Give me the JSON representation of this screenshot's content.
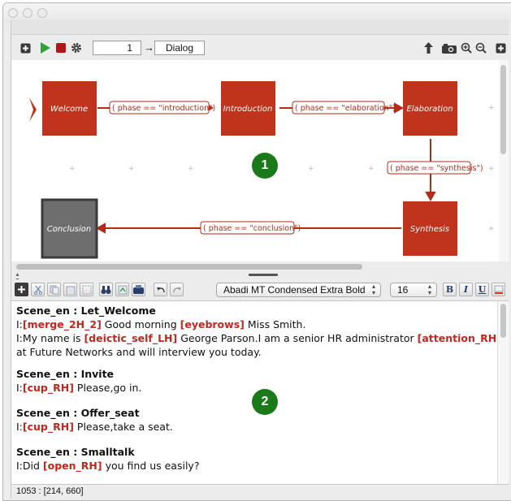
{
  "toolbar": {
    "phase_number": "1",
    "arrow": "→",
    "phase_name": "Dialog"
  },
  "flow": {
    "nodes": {
      "welcome": "Welcome",
      "introduction": "Introduction",
      "elaboration": "Elaboration",
      "synthesis": "Synthesis",
      "conclusion": "Conclusion"
    },
    "transitions": {
      "to_introduction": "( phase == \"introduction\")",
      "to_elaboration": "( phase == \"elaboration\")",
      "to_synthesis": "( phase == \"synthesis\")",
      "to_conclusion": "( phase == \"conclusion\")"
    },
    "grid_mark": "+"
  },
  "markers": {
    "one": "1",
    "two": "2"
  },
  "editor_toolbar": {
    "font_name": "Abadi MT Condensed Extra Bold",
    "font_size": "16",
    "bold": "B",
    "italic": "I",
    "underline": "U",
    "dropdown_arrows": "⌃⌄"
  },
  "script": {
    "scene1_title": "Scene_en : Let_Welcome",
    "s1l1_prefix": "I:",
    "s1l1_tag1": "[merge_2H_2]",
    "s1l1_text1": " Good morning ",
    "s1l1_tag2": "[eyebrows]",
    "s1l1_text2": " Miss Smith.",
    "s1l2_prefix": "I:My name is ",
    "s1l2_tag1": "[deictic_self_LH]",
    "s1l2_text1": " George Parson.I am a senior HR administrator ",
    "s1l2_tag2": "[attention_RH]",
    "s1l3_text": "at Future Networks and will interview you today.",
    "scene2_title": "Scene_en : Invite",
    "s2l1_prefix": "I:",
    "s2l1_tag": "[cup_RH]",
    "s2l1_text": " Please,go in.",
    "scene3_title": "Scene_en : Offer_seat",
    "s3l1_prefix": "I:",
    "s3l1_tag": "[cup_RH]",
    "s3l1_text": " Please,take a seat.",
    "scene4_title": "Scene_en : Smalltalk",
    "s4l1_prefix": "I:Did ",
    "s4l1_tag": "[open_RH]",
    "s4l1_text": " you find us easily?"
  },
  "status": {
    "text": "1053 : [214, 660]"
  },
  "colors": {
    "node_fill": "#c0341d",
    "node_inactive": "#6e6e6e",
    "edge": "#b52a18",
    "marker": "#1a7a1a",
    "tag": "#c0281e"
  }
}
